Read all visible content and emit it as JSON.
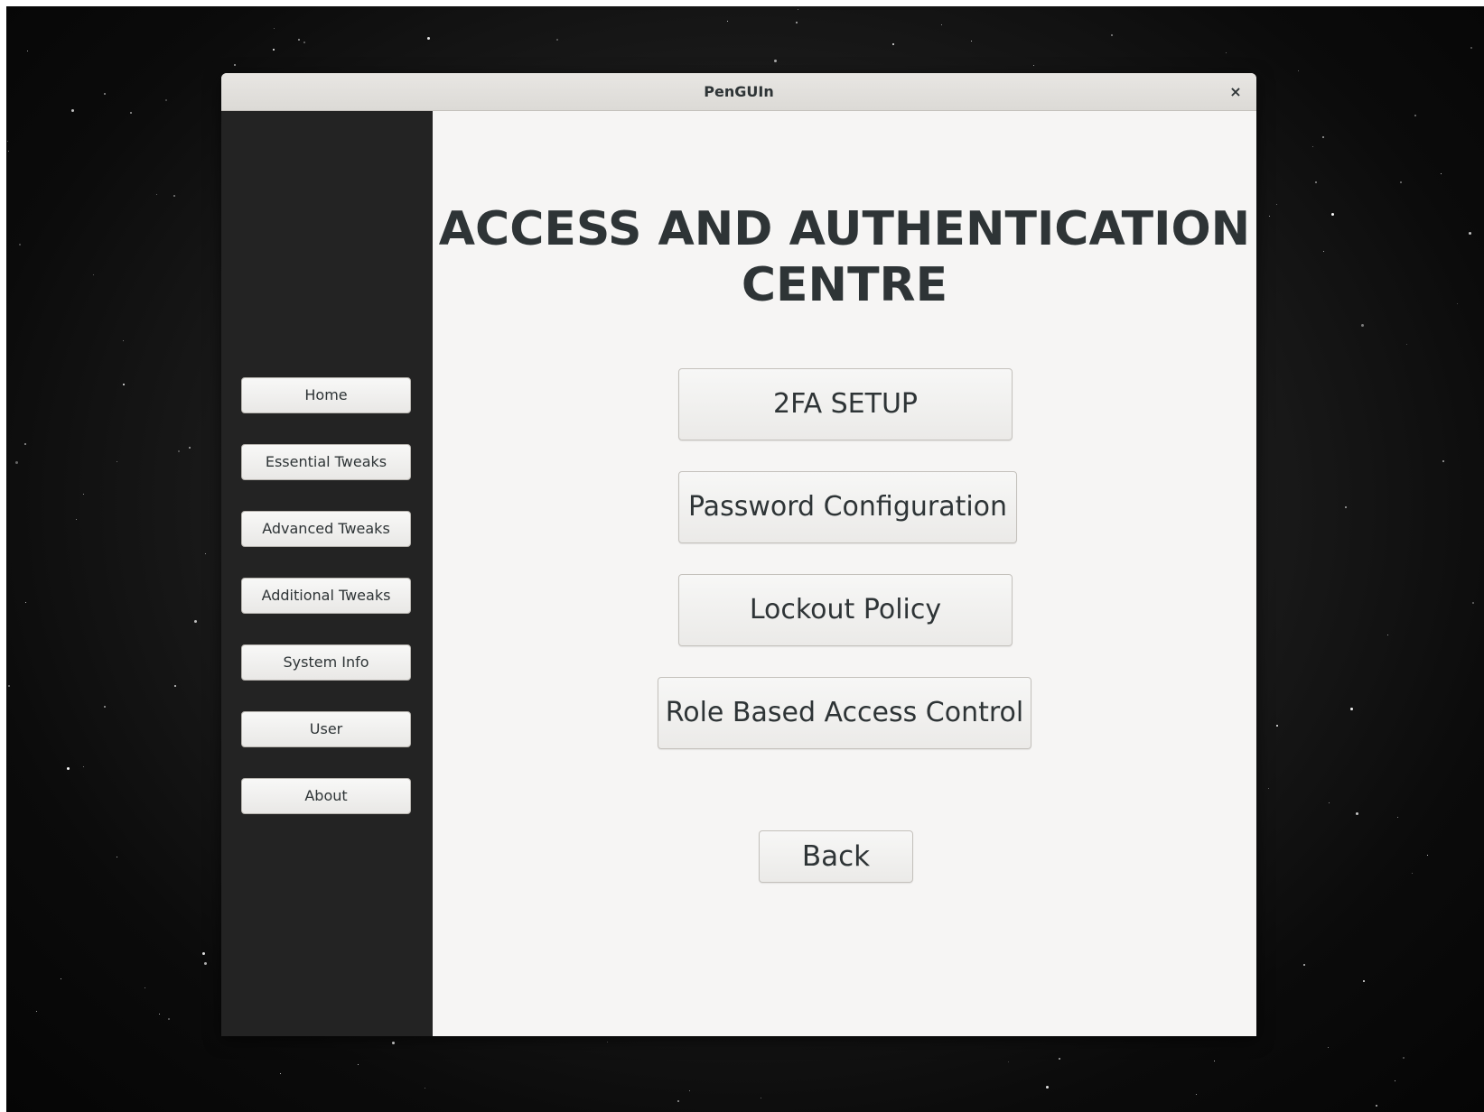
{
  "window": {
    "title": "PenGUIn",
    "close_label": "×"
  },
  "sidebar": {
    "items": [
      {
        "label": "Home"
      },
      {
        "label": "Essential Tweaks"
      },
      {
        "label": "Advanced Tweaks"
      },
      {
        "label": "Additional Tweaks"
      },
      {
        "label": "System Info"
      },
      {
        "label": "User"
      },
      {
        "label": "About"
      }
    ]
  },
  "main": {
    "heading_line1": "ACCESS AND AUTHENTICATION",
    "heading_line2": "CENTRE",
    "buttons": [
      {
        "label": "2FA SETUP"
      },
      {
        "label": "Password Configuration"
      },
      {
        "label": "Lockout Policy"
      },
      {
        "label": "Role Based Access Control"
      }
    ],
    "back_label": "Back"
  },
  "colors": {
    "sidebar_bg": "#232323",
    "content_bg": "#f6f5f4",
    "text": "#2e3436"
  }
}
